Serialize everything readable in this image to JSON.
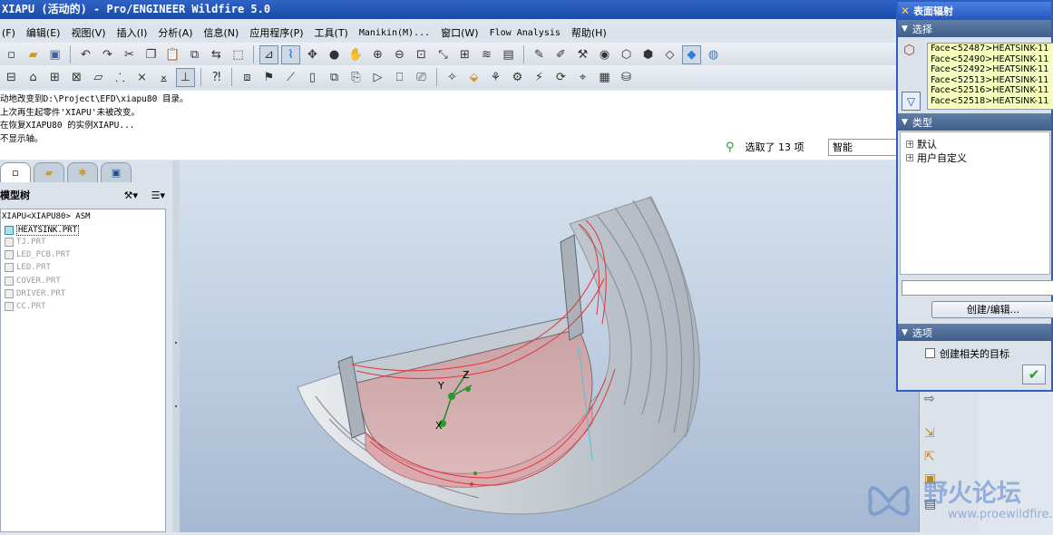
{
  "window": {
    "title": "XIAPU (活动的) - Pro/ENGINEER Wildfire 5.0"
  },
  "menu": {
    "items": [
      "(F)",
      "编辑(E)",
      "视图(V)",
      "插入(I)",
      "分析(A)",
      "信息(N)",
      "应用程序(P)",
      "工具(T)",
      "Manikin(M)...",
      "窗口(W)",
      "Flow Analysis",
      "帮助(H)"
    ]
  },
  "messages": [
    "动地改变到D:\\Project\\EFD\\xiapu80 目录。",
    "上次再生起零件'XIAPU'未被改变。",
    "在恢复XIAPU80 的实例XIAPU...",
    "不显示轴。"
  ],
  "status": {
    "selected_text": "选取了 13 项",
    "filter_value": "智能"
  },
  "model_tree": {
    "header": "模型树",
    "root": "XIAPU<XIAPU80> ASM",
    "items": [
      {
        "label": "HEATSINK.PRT",
        "selected": true
      },
      {
        "label": "TJ.PRT",
        "selected": false
      },
      {
        "label": "LED_PCB.PRT",
        "selected": false
      },
      {
        "label": "LED.PRT",
        "selected": false
      },
      {
        "label": "COVER.PRT",
        "selected": false
      },
      {
        "label": "DRIVER.PRT",
        "selected": false
      },
      {
        "label": "CC.PRT",
        "selected": false
      }
    ]
  },
  "viewport": {
    "axis_labels": {
      "x": "X",
      "y": "Y",
      "z": "Z"
    }
  },
  "dialog": {
    "title": "表面辐射",
    "section_select": "选择",
    "selections": [
      "Face<52487>HEATSINK-11",
      "Face<52490>HEATSINK-11",
      "Face<52492>HEATSINK-11",
      "Face<52513>HEATSINK-11",
      "Face<52516>HEATSINK-11",
      "Face<52518>HEATSINK-11"
    ],
    "section_type": "类型",
    "types": [
      "默认",
      "用户自定义"
    ],
    "create_edit_label": "创建/编辑...",
    "section_options": "选项",
    "option_label": "创建相关的目标"
  },
  "watermark": {
    "text": "野火论坛",
    "url": "www.proewildfire.cn"
  },
  "colors": {
    "title_blue": "#2456c0",
    "selection_bg": "#f7ffbe",
    "section_header": "#4f6f98",
    "viewport_bg": "#bccce0"
  }
}
